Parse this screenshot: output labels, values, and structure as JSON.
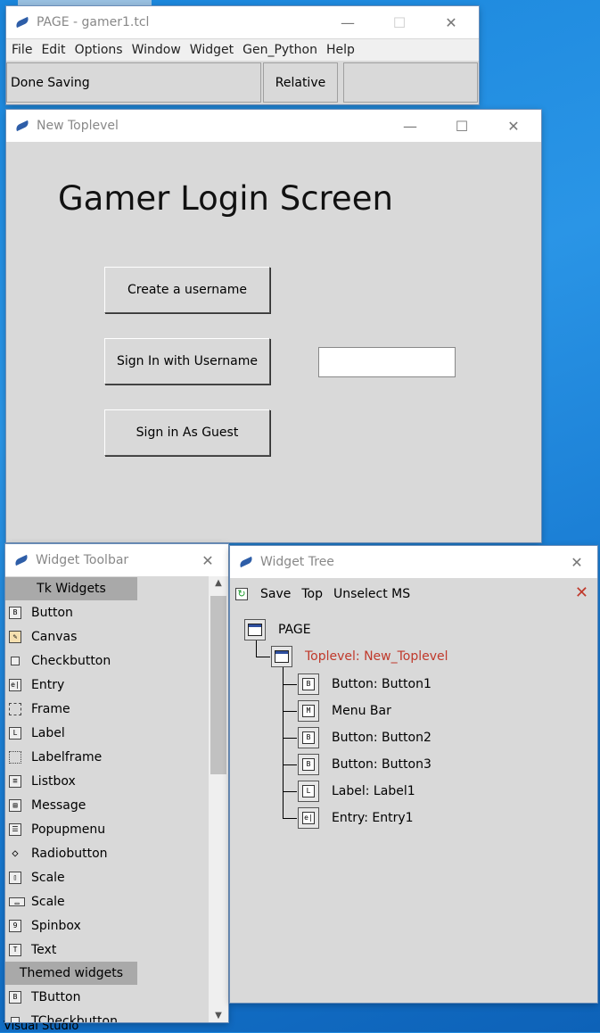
{
  "desktop": {
    "taskbar_label": "Visual Studio"
  },
  "page_main": {
    "title": "PAGE - gamer1.tcl",
    "menus": [
      "File",
      "Edit",
      "Options",
      "Window",
      "Widget",
      "Gen_Python",
      "Help"
    ],
    "status_text": "Done Saving",
    "mode_label": "Relative",
    "third_field": ""
  },
  "toplevel": {
    "title": "New Toplevel",
    "heading": "Gamer Login Screen",
    "buttons": [
      "Create a username",
      "Sign In with Username",
      "Sign in As Guest"
    ],
    "entry_value": ""
  },
  "toolbar": {
    "title": "Widget Toolbar",
    "tk_header": "Tk Widgets",
    "tk_items": [
      {
        "label": "Button",
        "icon": "button-icon"
      },
      {
        "label": "Canvas",
        "icon": "canvas-icon"
      },
      {
        "label": "Checkbutton",
        "icon": "checkbutton-icon"
      },
      {
        "label": "Entry",
        "icon": "entry-icon"
      },
      {
        "label": "Frame",
        "icon": "frame-icon"
      },
      {
        "label": "Label",
        "icon": "label-icon"
      },
      {
        "label": "Labelframe",
        "icon": "labelframe-icon"
      },
      {
        "label": "Listbox",
        "icon": "listbox-icon"
      },
      {
        "label": "Message",
        "icon": "message-icon"
      },
      {
        "label": "Popupmenu",
        "icon": "popupmenu-icon"
      },
      {
        "label": "Radiobutton",
        "icon": "radiobutton-icon"
      },
      {
        "label": "Scale",
        "icon": "vertical-scale-icon"
      },
      {
        "label": "Scale",
        "icon": "horizontal-scale-icon"
      },
      {
        "label": "Spinbox",
        "icon": "spinbox-icon"
      },
      {
        "label": "Text",
        "icon": "text-icon"
      }
    ],
    "themed_header": "Themed widgets",
    "themed_items": [
      {
        "label": "TButton",
        "icon": "tbutton-icon"
      },
      {
        "label": "TCheckbutton",
        "icon": "tcheckbutton-icon"
      }
    ]
  },
  "tree": {
    "title": "Widget Tree",
    "toolbar": {
      "save": "Save",
      "top": "Top",
      "unselect": "Unselect MS"
    },
    "accent_color": "#c0392b",
    "nodes": [
      {
        "label": "PAGE",
        "icon": "window-icon"
      },
      {
        "label": "Toplevel: New_Toplevel",
        "icon": "window-icon"
      },
      {
        "label": "Button: Button1",
        "icon": "button-icon"
      },
      {
        "label": "Menu Bar",
        "icon": "menu-icon"
      },
      {
        "label": "Button: Button2",
        "icon": "button-icon"
      },
      {
        "label": "Button: Button3",
        "icon": "button-icon"
      },
      {
        "label": "Label: Label1",
        "icon": "label-icon"
      },
      {
        "label": "Entry: Entry1",
        "icon": "entry-icon"
      }
    ]
  }
}
